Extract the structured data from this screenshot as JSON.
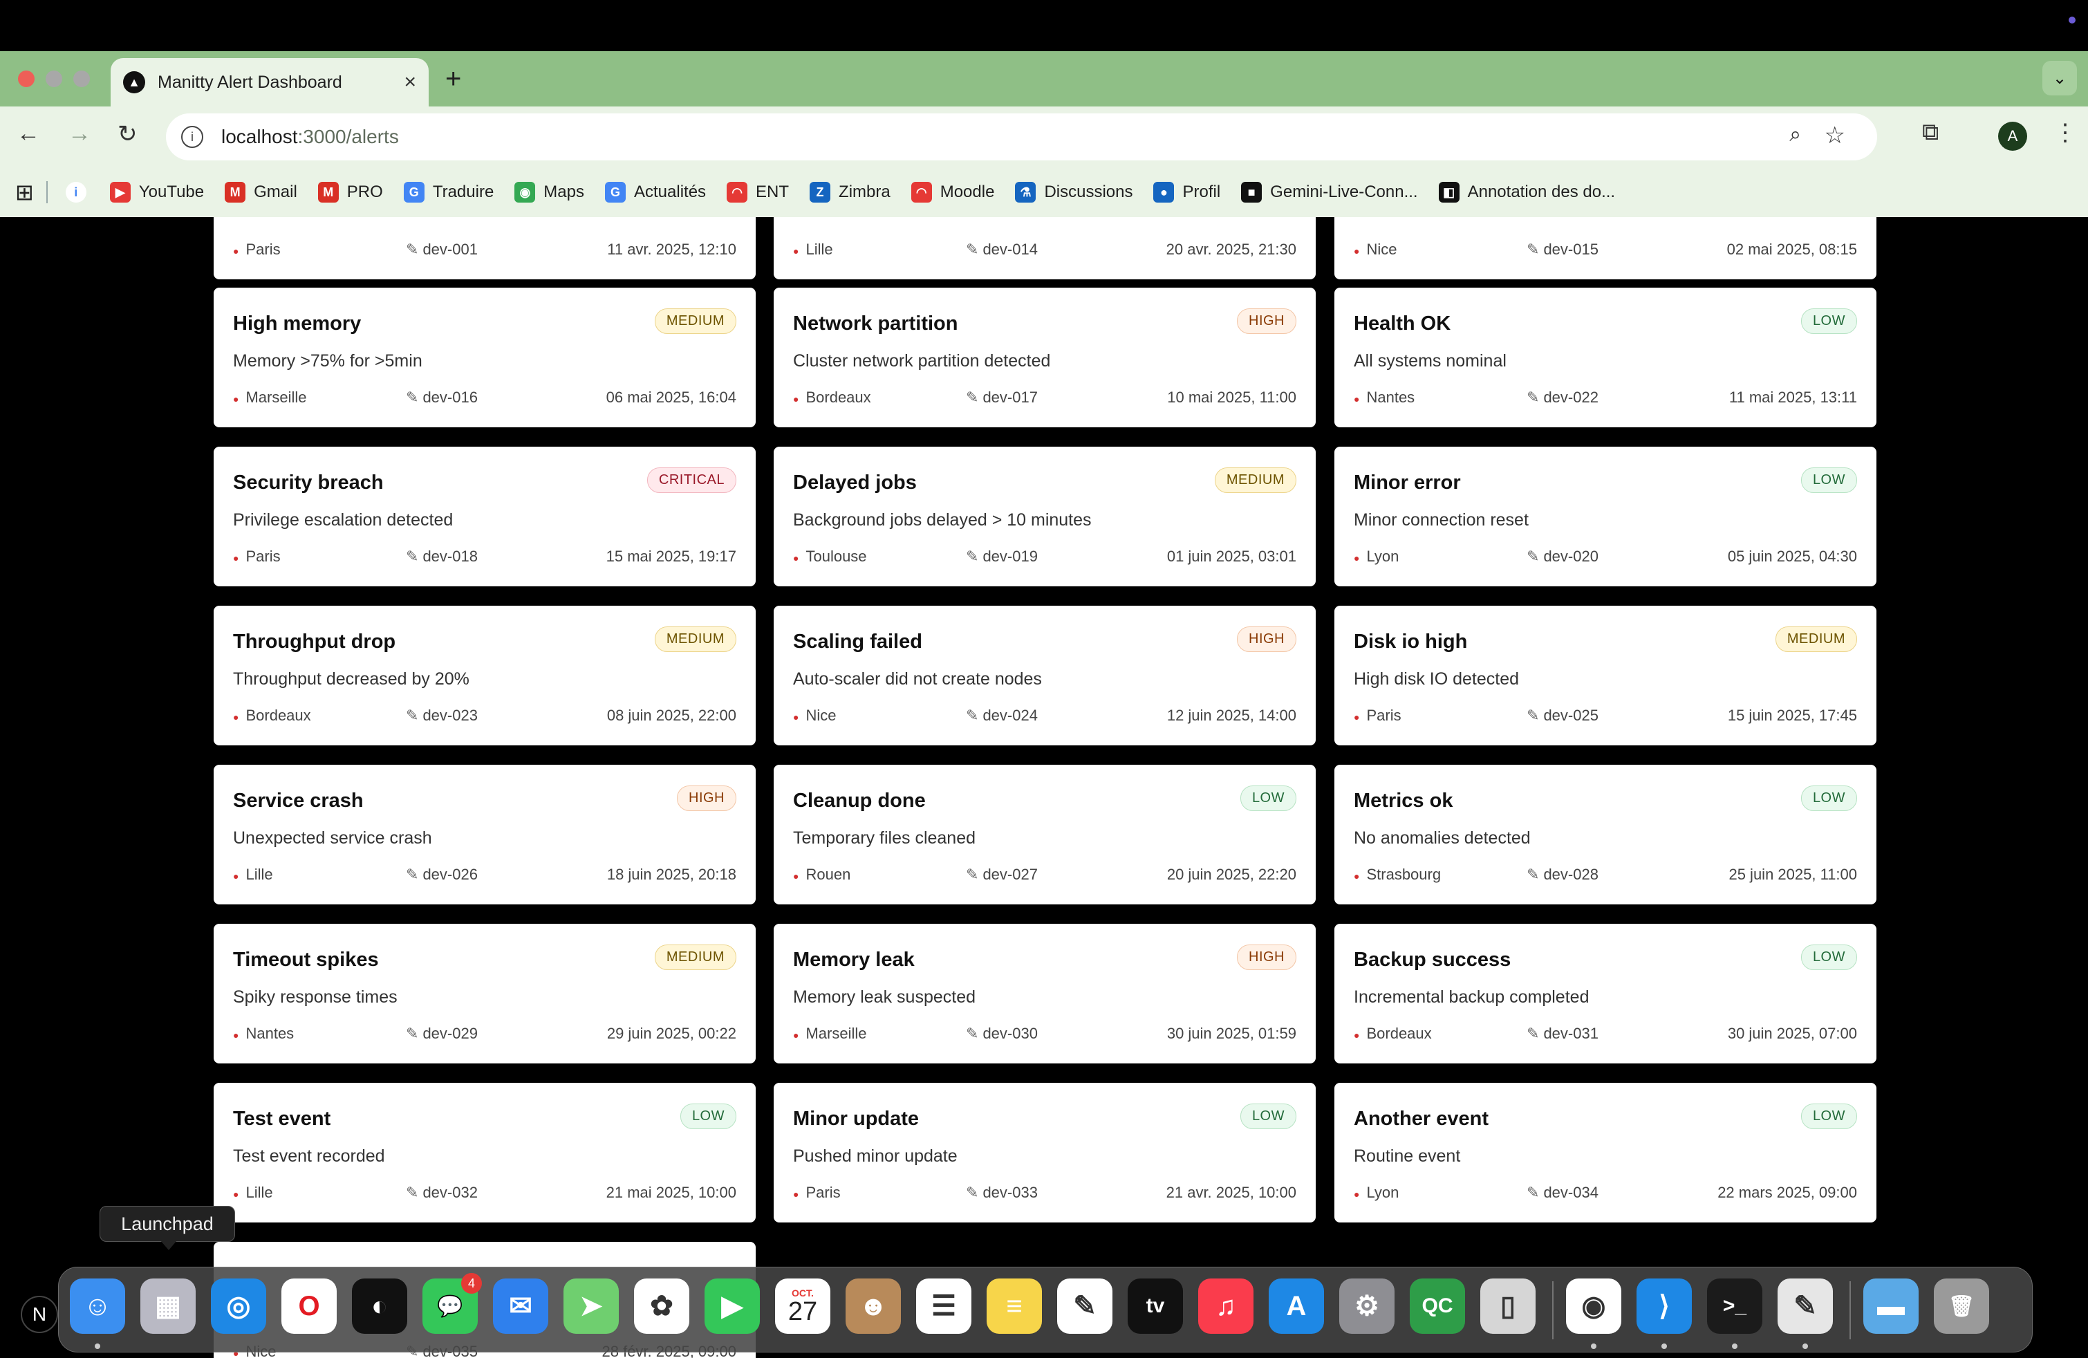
{
  "tab": {
    "title": "Manitty Alert Dashboard",
    "favicon": "triangle-logo-icon"
  },
  "address": {
    "host": "localhost",
    "path": ":3000/alerts"
  },
  "avatar_letter": "A",
  "bookmarks": [
    {
      "label": "YouTube",
      "icon": "youtube-icon",
      "color": "#e53935",
      "glyph": "▶"
    },
    {
      "label": "Gmail",
      "icon": "gmail-icon",
      "color": "#d93025",
      "glyph": "M"
    },
    {
      "label": "PRO",
      "icon": "gmail-icon",
      "color": "#d93025",
      "glyph": "M"
    },
    {
      "label": "Traduire",
      "icon": "translate-icon",
      "color": "#4285f4",
      "glyph": "G"
    },
    {
      "label": "Maps",
      "icon": "maps-icon",
      "color": "#34a853",
      "glyph": "◉"
    },
    {
      "label": "Actualités",
      "icon": "news-icon",
      "color": "#4285f4",
      "glyph": "G"
    },
    {
      "label": "ENT",
      "icon": "ent-icon",
      "color": "#e53935",
      "glyph": "◠"
    },
    {
      "label": "Zimbra",
      "icon": "zimbra-icon",
      "color": "#1565c0",
      "glyph": "Z"
    },
    {
      "label": "Moodle",
      "icon": "moodle-icon",
      "color": "#e53935",
      "glyph": "◠"
    },
    {
      "label": "Discussions",
      "icon": "discussions-icon",
      "color": "#1565c0",
      "glyph": "⚗"
    },
    {
      "label": "Profil",
      "icon": "profile-icon",
      "color": "#1565c0",
      "glyph": "●"
    },
    {
      "label": "Gemini-Live-Conn...",
      "icon": "github-icon",
      "color": "#111111",
      "glyph": "■"
    },
    {
      "label": "Annotation des do...",
      "icon": "annotation-icon",
      "color": "#111111",
      "glyph": "◧"
    }
  ],
  "partial_top_row": [
    {
      "location": "Paris",
      "device": "dev-001",
      "date": "11 avr. 2025, 12:10"
    },
    {
      "location": "Lille",
      "device": "dev-014",
      "date": "20 avr. 2025, 21:30"
    },
    {
      "location": "Nice",
      "device": "dev-015",
      "date": "02 mai 2025, 08:15"
    }
  ],
  "alerts": [
    {
      "title": "High memory",
      "severity": "MEDIUM",
      "level": "medium",
      "description": "Memory >75% for >5min",
      "location": "Marseille",
      "device": "dev-016",
      "date": "06 mai 2025, 16:04"
    },
    {
      "title": "Network partition",
      "severity": "HIGH",
      "level": "high",
      "description": "Cluster network partition detected",
      "location": "Bordeaux",
      "device": "dev-017",
      "date": "10 mai 2025, 11:00"
    },
    {
      "title": "Health OK",
      "severity": "LOW",
      "level": "low",
      "description": "All systems nominal",
      "location": "Nantes",
      "device": "dev-022",
      "date": "11 mai 2025, 13:11"
    },
    {
      "title": "Security breach",
      "severity": "CRITICAL",
      "level": "critical",
      "description": "Privilege escalation detected",
      "location": "Paris",
      "device": "dev-018",
      "date": "15 mai 2025, 19:17"
    },
    {
      "title": "Delayed jobs",
      "severity": "MEDIUM",
      "level": "medium",
      "description": "Background jobs delayed > 10 minutes",
      "location": "Toulouse",
      "device": "dev-019",
      "date": "01 juin 2025, 03:01"
    },
    {
      "title": "Minor error",
      "severity": "LOW",
      "level": "low",
      "description": "Minor connection reset",
      "location": "Lyon",
      "device": "dev-020",
      "date": "05 juin 2025, 04:30"
    },
    {
      "title": "Throughput drop",
      "severity": "MEDIUM",
      "level": "medium",
      "description": "Throughput decreased by 20%",
      "location": "Bordeaux",
      "device": "dev-023",
      "date": "08 juin 2025, 22:00"
    },
    {
      "title": "Scaling failed",
      "severity": "HIGH",
      "level": "high",
      "description": "Auto-scaler did not create nodes",
      "location": "Nice",
      "device": "dev-024",
      "date": "12 juin 2025, 14:00"
    },
    {
      "title": "Disk io high",
      "severity": "MEDIUM",
      "level": "medium",
      "description": "High disk IO detected",
      "location": "Paris",
      "device": "dev-025",
      "date": "15 juin 2025, 17:45"
    },
    {
      "title": "Service crash",
      "severity": "HIGH",
      "level": "high",
      "description": "Unexpected service crash",
      "location": "Lille",
      "device": "dev-026",
      "date": "18 juin 2025, 20:18"
    },
    {
      "title": "Cleanup done",
      "severity": "LOW",
      "level": "low",
      "description": "Temporary files cleaned",
      "location": "Rouen",
      "device": "dev-027",
      "date": "20 juin 2025, 22:20"
    },
    {
      "title": "Metrics ok",
      "severity": "LOW",
      "level": "low",
      "description": "No anomalies detected",
      "location": "Strasbourg",
      "device": "dev-028",
      "date": "25 juin 2025, 11:00"
    },
    {
      "title": "Timeout spikes",
      "severity": "MEDIUM",
      "level": "medium",
      "description": "Spiky response times",
      "location": "Nantes",
      "device": "dev-029",
      "date": "29 juin 2025, 00:22"
    },
    {
      "title": "Memory leak",
      "severity": "HIGH",
      "level": "high",
      "description": "Memory leak suspected",
      "location": "Marseille",
      "device": "dev-030",
      "date": "30 juin 2025, 01:59"
    },
    {
      "title": "Backup success",
      "severity": "LOW",
      "level": "low",
      "description": "Incremental backup completed",
      "location": "Bordeaux",
      "device": "dev-031",
      "date": "30 juin 2025, 07:00"
    },
    {
      "title": "Test event",
      "severity": "LOW",
      "level": "low",
      "description": "Test event recorded",
      "location": "Lille",
      "device": "dev-032",
      "date": "21 mai 2025, 10:00"
    },
    {
      "title": "Minor update",
      "severity": "LOW",
      "level": "low",
      "description": "Pushed minor update",
      "location": "Paris",
      "device": "dev-033",
      "date": "21 avr. 2025, 10:00"
    },
    {
      "title": "Another event",
      "severity": "LOW",
      "level": "low",
      "description": "Routine event",
      "location": "Lyon",
      "device": "dev-034",
      "date": "22 mars 2025, 09:00"
    }
  ],
  "partial_bottom_card": {
    "location": "Nice",
    "device": "dev-035",
    "date": "28 févr. 2025, 09:00"
  },
  "dock": {
    "tooltip": "Launchpad",
    "left_badge": "N",
    "calendar_month": "OCT.",
    "calendar_day": "27",
    "messages_badge": "4",
    "apps": [
      {
        "name": "finder-icon",
        "bg": "#3b8ff0",
        "glyph": "☺"
      },
      {
        "name": "launchpad-icon",
        "bg": "#b9b9c4",
        "glyph": "▦"
      },
      {
        "name": "safari-icon",
        "bg": "#1e88e5",
        "glyph": "◎"
      },
      {
        "name": "opera-icon",
        "bg": "#ffffff",
        "glyph": "O"
      },
      {
        "name": "app-wave-icon",
        "bg": "#111111",
        "glyph": "◐"
      },
      {
        "name": "messages-icon",
        "bg": "#34c759",
        "glyph": "💬"
      },
      {
        "name": "mail-icon",
        "bg": "#2f80ed",
        "glyph": "✉"
      },
      {
        "name": "maps-app-icon",
        "bg": "#6fcf6f",
        "glyph": "➤"
      },
      {
        "name": "photos-icon",
        "bg": "#ffffff",
        "glyph": "✿"
      },
      {
        "name": "facetime-icon",
        "bg": "#34c759",
        "glyph": "▶"
      },
      {
        "name": "calendar-icon",
        "bg": "#ffffff",
        "glyph": ""
      },
      {
        "name": "contacts-icon",
        "bg": "#b88a5a",
        "glyph": "☻"
      },
      {
        "name": "reminders-icon",
        "bg": "#ffffff",
        "glyph": "☰"
      },
      {
        "name": "notes-icon",
        "bg": "#f7d54a",
        "glyph": "≡"
      },
      {
        "name": "freeform-icon",
        "bg": "#ffffff",
        "glyph": "✎"
      },
      {
        "name": "apple-tv-icon",
        "bg": "#111111",
        "glyph": "tv"
      },
      {
        "name": "music-icon",
        "bg": "#fa3c4c",
        "glyph": "♫"
      },
      {
        "name": "app-store-icon",
        "bg": "#1e88e5",
        "glyph": "A"
      },
      {
        "name": "system-settings-icon",
        "bg": "#8e8e93",
        "glyph": "⚙"
      },
      {
        "name": "qc-app-icon",
        "bg": "#2e9d48",
        "glyph": "QC"
      },
      {
        "name": "iphone-mirroring-icon",
        "bg": "#d6d6d6",
        "glyph": "▯"
      },
      {
        "name": "chrome-icon",
        "bg": "#ffffff",
        "glyph": "◉"
      },
      {
        "name": "vscode-icon",
        "bg": "#1e88e5",
        "glyph": "⟩"
      },
      {
        "name": "terminal-icon",
        "bg": "#1b1b1b",
        "glyph": ">_"
      },
      {
        "name": "script-editor-icon",
        "bg": "#e6e6e6",
        "glyph": "✎"
      },
      {
        "name": "downloads-folder-icon",
        "bg": "#5aa9e6",
        "glyph": "▬"
      },
      {
        "name": "trash-icon",
        "bg": "#9a9a9a",
        "glyph": "🗑"
      }
    ]
  }
}
